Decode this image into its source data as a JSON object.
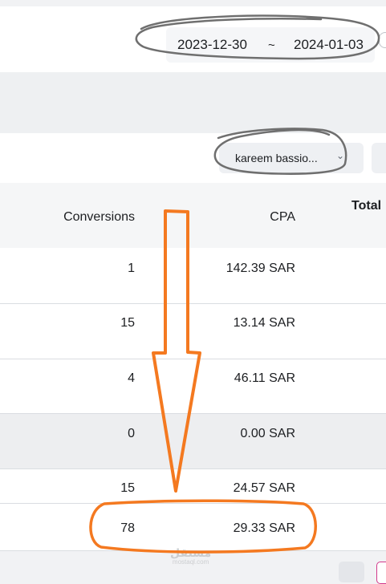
{
  "date_range": {
    "start": "2023-12-30",
    "separator": "~",
    "end": "2024-01-03"
  },
  "account_filter": {
    "selected": "kareem bassio..."
  },
  "table": {
    "columns": {
      "conversions": "Conversions",
      "cpa": "CPA",
      "total": "Total"
    },
    "rows": [
      {
        "conversions": "1",
        "cpa": "142.39 SAR",
        "highlighted": false
      },
      {
        "conversions": "15",
        "cpa": "13.14 SAR",
        "highlighted": false
      },
      {
        "conversions": "4",
        "cpa": "46.11 SAR",
        "highlighted": false
      },
      {
        "conversions": "0",
        "cpa": "0.00 SAR",
        "highlighted": true
      },
      {
        "conversions": "15",
        "cpa": "24.57 SAR",
        "highlighted": false
      },
      {
        "conversions": "78",
        "cpa": "29.33 SAR",
        "highlighted": false
      }
    ]
  },
  "watermark": {
    "arabic": "مستقل",
    "latin": "mostaql.com"
  },
  "annotation_colors": {
    "marker": "#f47920",
    "scribble": "#6f6f6f"
  }
}
